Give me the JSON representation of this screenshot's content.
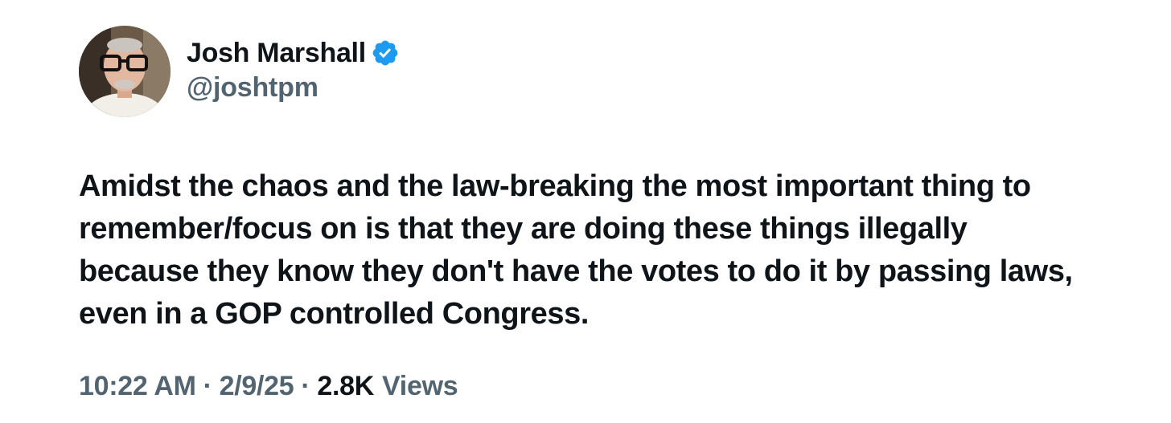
{
  "author": {
    "display_name": "Josh Marshall",
    "handle": "@joshtpm",
    "verified_icon": "verified-badge-icon",
    "avatar": "avatar-photo"
  },
  "tweet": {
    "lines": [
      "Amidst the chaos and the law-breaking the most important thing to",
      "remember/focus on is that they are doing these things illegally",
      "because they know they don't have the votes to do it by passing laws,",
      "even in a GOP controlled Congress."
    ]
  },
  "meta": {
    "time": "10:22 AM",
    "separator": "·",
    "date": "2/9/25",
    "views_count": "2.8K",
    "views_label": "Views"
  },
  "colors": {
    "text_primary": "#0f1419",
    "text_secondary": "#536471",
    "verified_blue": "#1d9bf0",
    "background": "#ffffff"
  }
}
